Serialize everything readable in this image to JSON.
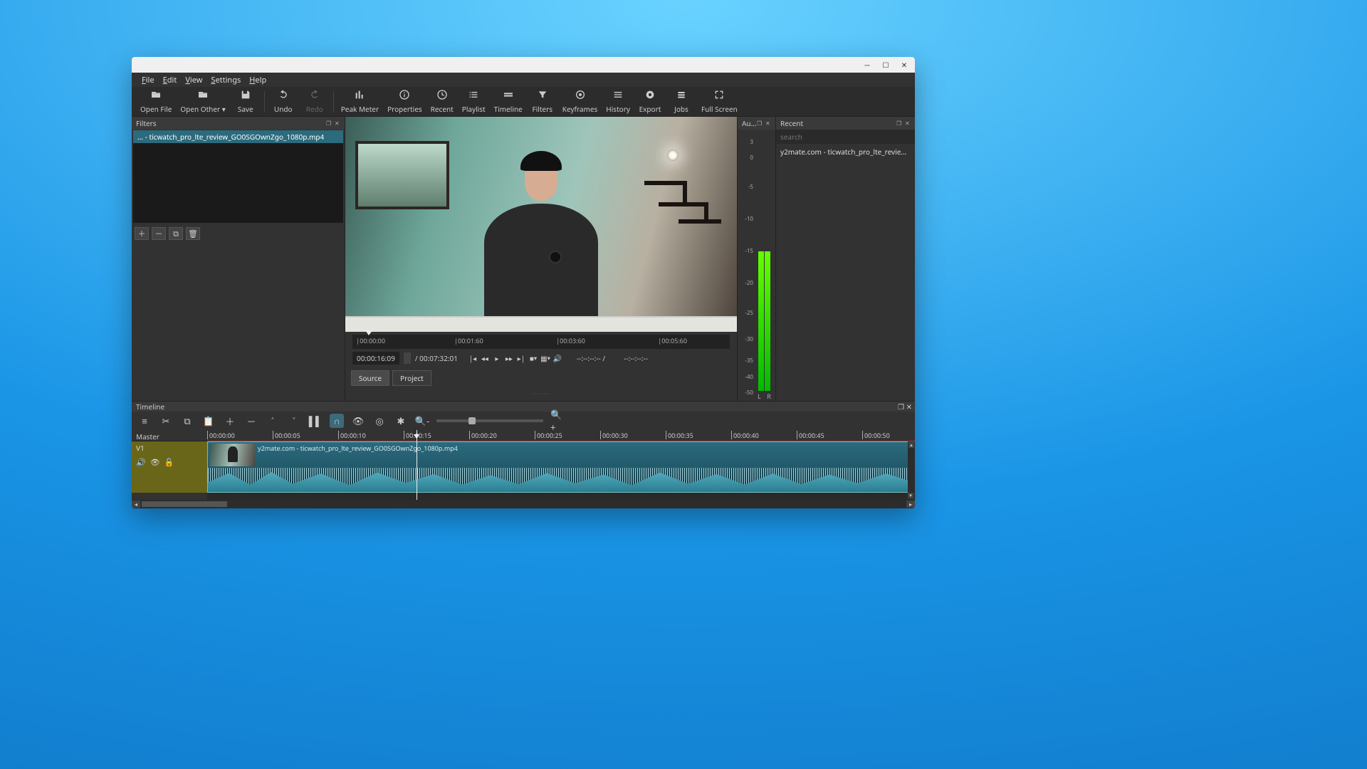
{
  "window": {
    "title": ""
  },
  "menu": [
    "File",
    "Edit",
    "View",
    "Settings",
    "Help"
  ],
  "toolbar": [
    {
      "label": "Open File",
      "icon": "open"
    },
    {
      "label": "Open Other",
      "icon": "open-other",
      "caret": true
    },
    {
      "label": "Save",
      "icon": "save"
    },
    {
      "sep": true
    },
    {
      "label": "Undo",
      "icon": "undo"
    },
    {
      "label": "Redo",
      "icon": "redo",
      "disabled": true
    },
    {
      "sep": true
    },
    {
      "label": "Peak Meter",
      "icon": "meter"
    },
    {
      "label": "Properties",
      "icon": "info"
    },
    {
      "label": "Recent",
      "icon": "clock"
    },
    {
      "label": "Playlist",
      "icon": "list"
    },
    {
      "label": "Timeline",
      "icon": "timeline"
    },
    {
      "label": "Filters",
      "icon": "filter"
    },
    {
      "label": "Keyframes",
      "icon": "keyframes"
    },
    {
      "label": "History",
      "icon": "history"
    },
    {
      "label": "Export",
      "icon": "export"
    },
    {
      "label": "Jobs",
      "icon": "jobs"
    },
    {
      "label": "Full Screen",
      "icon": "fullscreen"
    }
  ],
  "filters": {
    "title": "Filters",
    "file": "... - ticwatch_pro_lte_review_GO0SGOwnZgo_1080p.mp4",
    "buttons": [
      "add",
      "remove",
      "copy",
      "delete"
    ]
  },
  "viewer": {
    "scrub_ticks": [
      {
        "label": "00:00:00",
        "pct": 1
      },
      {
        "label": "00:01:60",
        "pct": 27
      },
      {
        "label": "00:03:60",
        "pct": 54
      },
      {
        "label": "00:05:60",
        "pct": 81
      }
    ],
    "timecode": "00:00:16:09",
    "duration": "/ 00:07:32:01",
    "in_out": "--:--:--:-- /",
    "in_out2": "--:--:--:--",
    "tabs": [
      {
        "label": "Source",
        "active": true
      },
      {
        "label": "Project",
        "active": false
      }
    ]
  },
  "audio": {
    "title": "Au...",
    "ticks": [
      {
        "v": "3",
        "pct": 2
      },
      {
        "v": "0",
        "pct": 8
      },
      {
        "v": "-5",
        "pct": 19
      },
      {
        "v": "-10",
        "pct": 31
      },
      {
        "v": "-15",
        "pct": 43
      },
      {
        "v": "-20",
        "pct": 55
      },
      {
        "v": "-25",
        "pct": 66
      },
      {
        "v": "-30",
        "pct": 76
      },
      {
        "v": "-35",
        "pct": 84
      },
      {
        "v": "-40",
        "pct": 90
      },
      {
        "v": "-50",
        "pct": 96
      }
    ],
    "bar_height_pct": 54,
    "chan": [
      "L",
      "R"
    ]
  },
  "recent": {
    "title": "Recent",
    "search_placeholder": "search",
    "items": [
      "y2mate.com - ticwatch_pro_lte_review_…"
    ]
  },
  "timeline": {
    "title": "Timeline",
    "master": "Master",
    "track": "V1",
    "clip_label": "y2mate.com - ticwatch_pro_lte_review_GO0SGOwnZgo_1080p.mp4",
    "ruler": [
      "00:00:00",
      "00:00:05",
      "00:00:10",
      "00:00:15",
      "00:00:20",
      "00:00:25",
      "00:00:30",
      "00:00:35",
      "00:00:40",
      "00:00:45",
      "00:00:50"
    ],
    "playhead_pct": 30
  }
}
